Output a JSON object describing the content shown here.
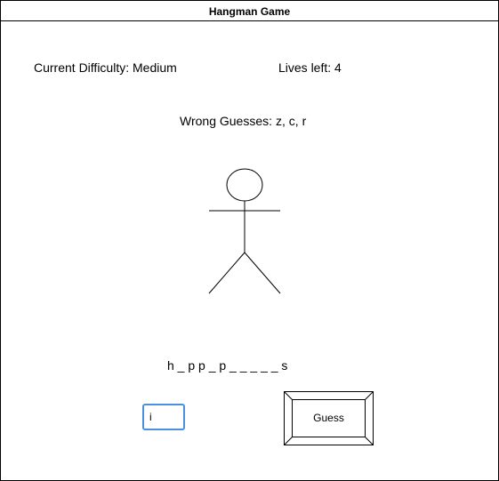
{
  "window": {
    "title": "Hangman Game"
  },
  "status": {
    "difficulty_label": "Current Difficulty:",
    "difficulty_value": "Medium",
    "lives_label": "Lives left:",
    "lives_value": "4",
    "wrong_label": "Wrong Guesses:",
    "wrong_value": "z, c, r"
  },
  "hangman": {
    "parts_drawn": [
      "head",
      "arms",
      "body",
      "left-leg",
      "right-leg"
    ]
  },
  "word": {
    "display": "h _ p p _ p _ _ _ _ _ s"
  },
  "guess": {
    "input_value": "i",
    "button_label": "Guess"
  },
  "colors": {
    "input_focus_border": "#4a90e2",
    "line": "#000000"
  }
}
